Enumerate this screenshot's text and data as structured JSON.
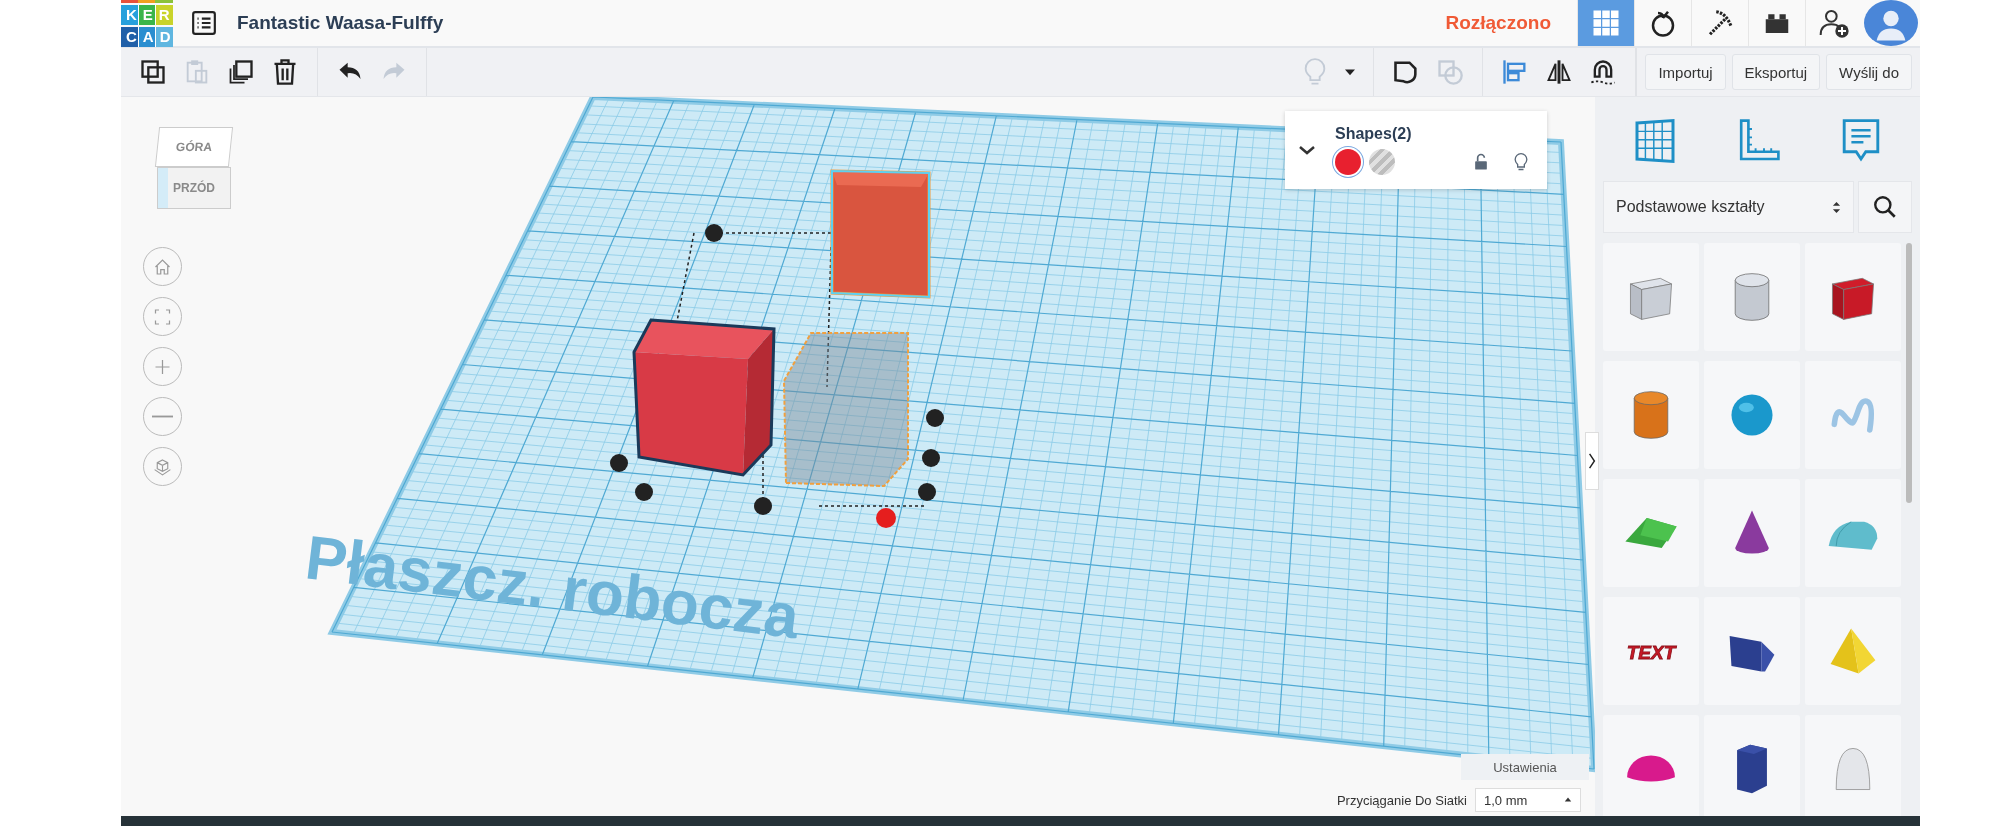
{
  "header": {
    "logo_rows": [
      "KER",
      "CAD"
    ],
    "title": "Fantastic Waasa-Fulffy",
    "status": "Rozłączono",
    "view_tabs": [
      {
        "kind": "grid",
        "selected": true
      },
      {
        "kind": "codeblocks",
        "selected": false
      },
      {
        "kind": "pickaxe",
        "selected": false
      },
      {
        "kind": "brick",
        "selected": false
      }
    ]
  },
  "toolbar": {
    "tool_groups": [
      [
        {
          "kind": "copy",
          "disabled": false
        },
        {
          "kind": "paste",
          "disabled": true
        },
        {
          "kind": "duplicate",
          "disabled": false
        },
        {
          "kind": "delete",
          "disabled": false
        }
      ],
      [
        {
          "kind": "undo",
          "disabled": false
        },
        {
          "kind": "redo",
          "disabled": true
        }
      ],
      [
        {
          "kind": "bulb",
          "disabled": true
        },
        {
          "kind": "caret",
          "disabled": false
        }
      ],
      [
        {
          "kind": "group",
          "disabled": false
        },
        {
          "kind": "ungroup",
          "disabled": true
        }
      ],
      [
        {
          "kind": "align",
          "disabled": false
        },
        {
          "kind": "mirror",
          "disabled": false
        },
        {
          "kind": "magnet",
          "disabled": false
        }
      ]
    ],
    "buttons": [
      "Importuj",
      "Eksportuj",
      "Wyślij do"
    ]
  },
  "view_cube": {
    "top": "GÓRA",
    "front": "PRZÓD"
  },
  "shapes_panel": {
    "title": "Shapes(2)",
    "expanded": true,
    "locked": false,
    "swatches": [
      {
        "kind": "solid",
        "color": "#e8202f",
        "selected": true
      },
      {
        "kind": "hole",
        "selected": false
      }
    ]
  },
  "workplane": {
    "label": "Płaszcz. robocza"
  },
  "settings_button": "Ustawienia",
  "snap": {
    "label": "Przyciąganie Do Siatki",
    "value": "1,0 mm"
  },
  "library": {
    "category": "Podstawowe kształty",
    "text_shape": "TEXT"
  }
}
